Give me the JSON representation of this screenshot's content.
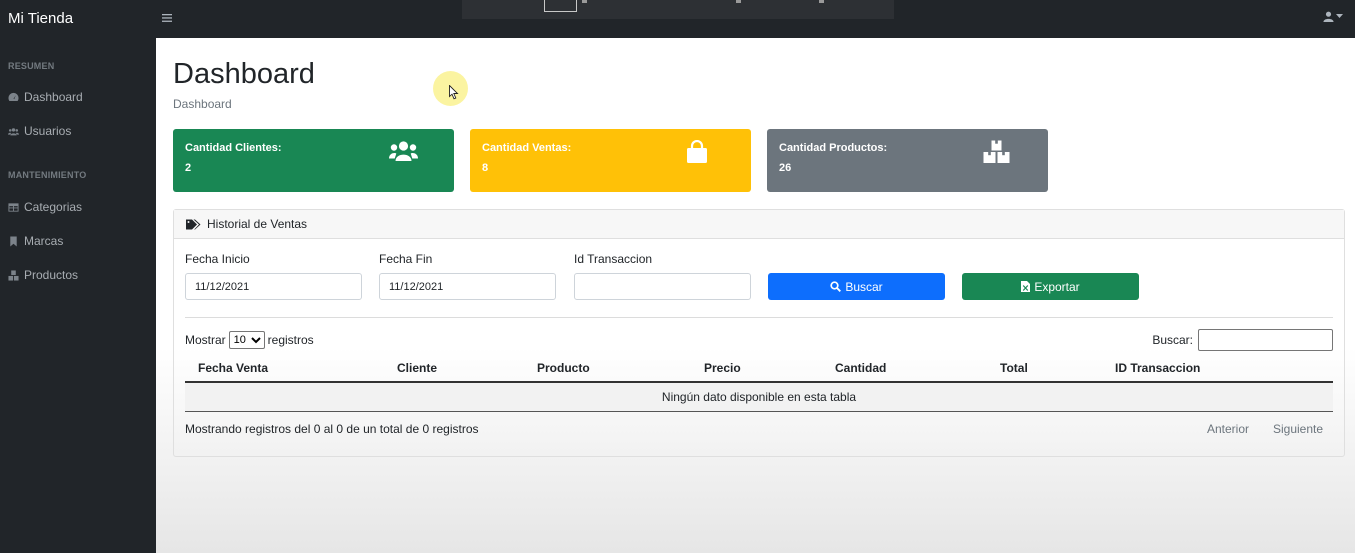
{
  "app": {
    "title": "Mi Tienda"
  },
  "topbar": {
    "toggle_icon": "bars-icon",
    "user_icon": "user-icon"
  },
  "sidebar": {
    "sections": [
      {
        "heading": "RESUMEN",
        "items": [
          {
            "label": "Dashboard",
            "icon": "tachometer-icon"
          },
          {
            "label": "Usuarios",
            "icon": "users-icon"
          }
        ]
      },
      {
        "heading": "MANTENIMIENTO",
        "items": [
          {
            "label": "Categorias",
            "icon": "table-icon"
          },
          {
            "label": "Marcas",
            "icon": "bookmark-icon"
          },
          {
            "label": "Productos",
            "icon": "boxes-icon"
          }
        ]
      }
    ]
  },
  "page": {
    "title": "Dashboard",
    "breadcrumb": "Dashboard"
  },
  "stats": [
    {
      "label": "Cantidad Clientes:",
      "value": "2",
      "color": "#198754",
      "icon": "users-icon"
    },
    {
      "label": "Cantidad Ventas:",
      "value": "8",
      "color": "#ffc107",
      "icon": "shopping-bag-icon"
    },
    {
      "label": "Cantidad Productos:",
      "value": "26",
      "color": "#6c757d",
      "icon": "boxes-icon"
    }
  ],
  "history": {
    "title": "Historial de Ventas",
    "fields": {
      "start_label": "Fecha Inicio",
      "start_value": "11/12/2021",
      "end_label": "Fecha Fin",
      "end_value": "11/12/2021",
      "txn_label": "Id Transaccion",
      "txn_value": ""
    },
    "buttons": {
      "search": "Buscar",
      "export": "Exportar"
    },
    "table": {
      "length_prefix": "Mostrar",
      "length_value": "10",
      "length_suffix": "registros",
      "search_label": "Buscar:",
      "columns": [
        "Fecha Venta",
        "Cliente",
        "Producto",
        "Precio",
        "Cantidad",
        "Total",
        "ID Transaccion"
      ],
      "empty_message": "Ningún dato disponible en esta tabla",
      "info": "Mostrando registros del 0 al 0 de un total de 0 registros",
      "prev": "Anterior",
      "next": "Siguiente"
    }
  },
  "colors": {
    "primary": "#0d6efd",
    "success": "#198754",
    "warning": "#ffc107",
    "secondary": "#6c757d",
    "dark": "#212529"
  }
}
